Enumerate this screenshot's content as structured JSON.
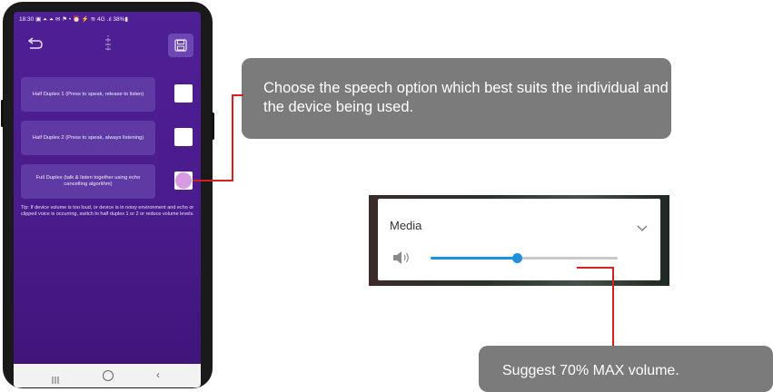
{
  "status_bar": {
    "text": "18:30 ▣ ⏶ ⏶ ✉ ⚑ •    ⏰ ⚡ ≋ 4G .ıl 38%▮"
  },
  "toolbar": {
    "back_icon": "back-arrow-icon",
    "center_icon": "volume-bars-icon",
    "save_icon": "save-disk-icon"
  },
  "options": [
    {
      "label": "Half Duplex 1 (Press to speak, release to listen)",
      "selected": false
    },
    {
      "label": "Half Duplex 2 (Press to speak, always listening)",
      "selected": false
    },
    {
      "label": "Full Duplex (talk & listen together using echo cancelling algorithm)",
      "selected": true
    }
  ],
  "tip": "Tip: If device volume is too loud, or device is in noisy environment and echo or clipped voice is occurring, switch to half duplex 1 or 2 or reduce volume levels.",
  "navbar": {
    "recent": "|||",
    "home": "○",
    "back": "‹"
  },
  "callouts": {
    "speech_option": "Choose the speech option which best suits the individual and the device being used.",
    "volume": "Suggest 70% MAX volume."
  },
  "media_panel": {
    "label": "Media",
    "volume_fraction": 0.46
  },
  "colors": {
    "app_background": "#4b1f8a",
    "option_card": "#5f3aa5",
    "selected_dot": "#d69be0",
    "callout_bg": "#7b7b7b",
    "leader_line": "#d62020",
    "slider_accent": "#1f8fe0"
  }
}
